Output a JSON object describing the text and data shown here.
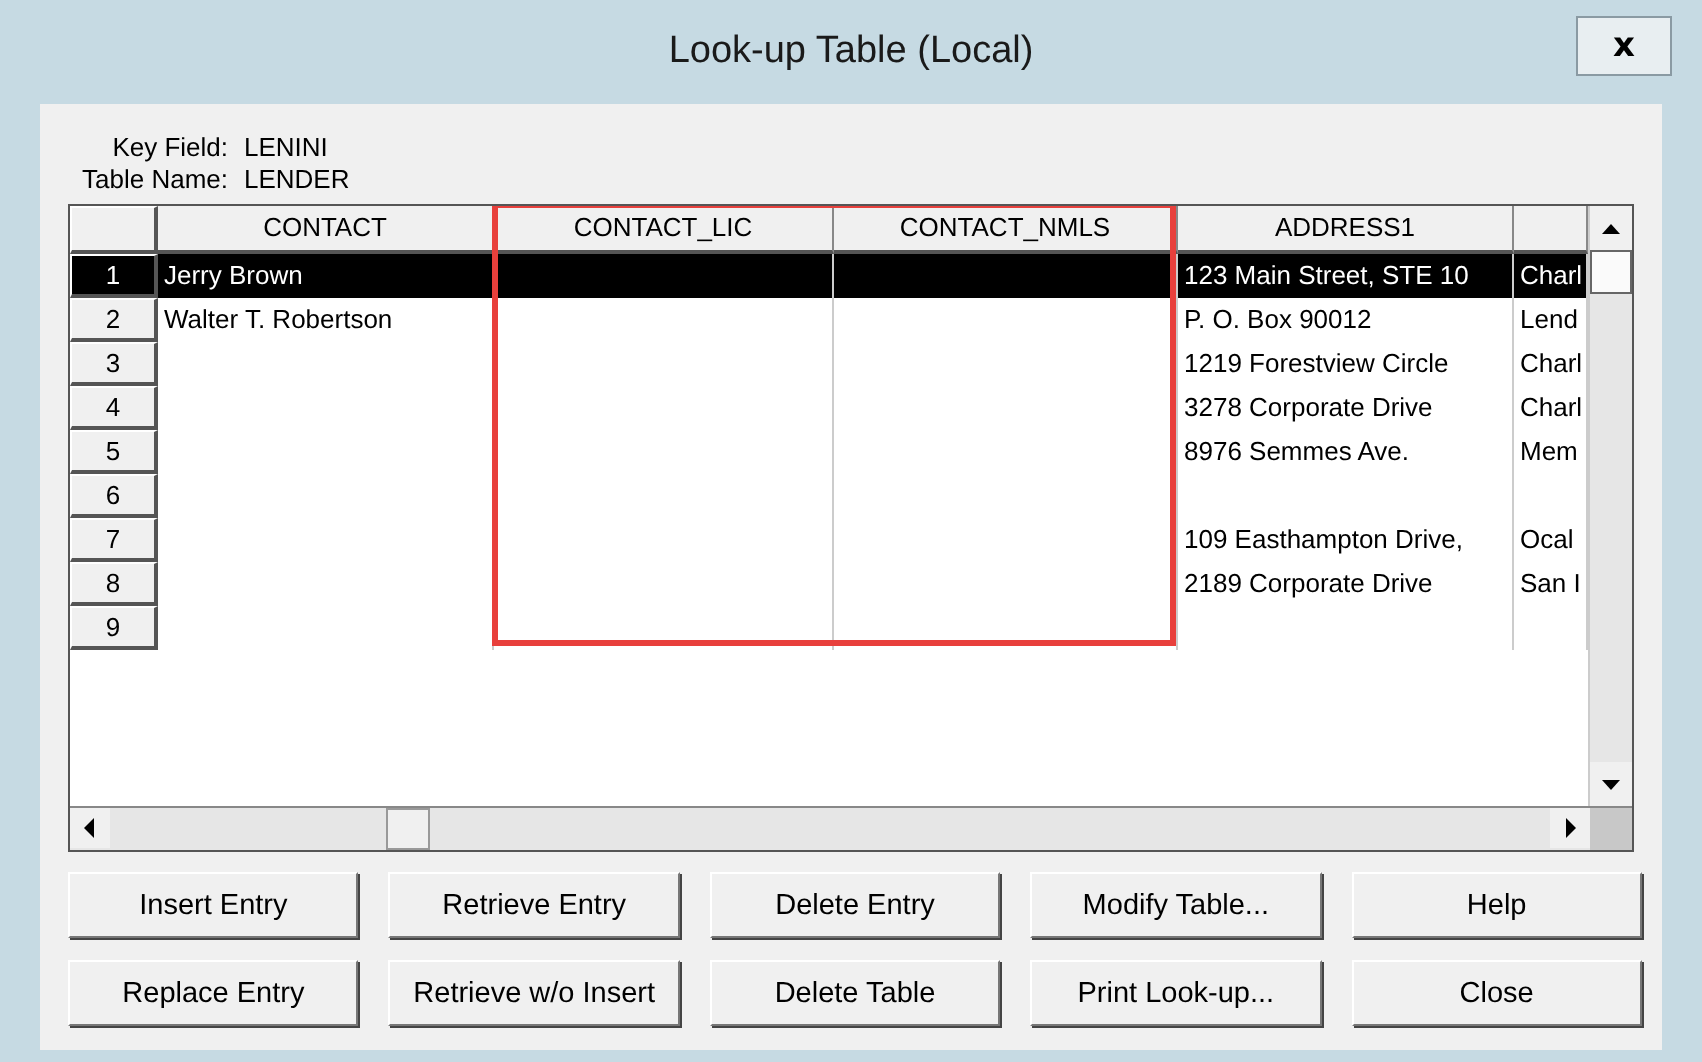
{
  "window": {
    "title": "Look-up Table (Local)",
    "close": "x"
  },
  "key_field": {
    "label": "Key Field:",
    "value": "LENINI"
  },
  "table_name": {
    "label": "Table Name:",
    "value": "LENDER"
  },
  "table": {
    "columns": [
      {
        "label": "CONTACT",
        "highlighted": false
      },
      {
        "label": "CONTACT_LIC",
        "highlighted": true
      },
      {
        "label": "CONTACT_NMLS",
        "highlighted": true
      },
      {
        "label": "ADDRESS1",
        "highlighted": false
      }
    ],
    "rows": [
      {
        "number": "1",
        "selected": true,
        "contact": "Jerry Brown",
        "address1": "123 Main Street, STE 10",
        "column_5": "Charl"
      },
      {
        "number": "2",
        "selected": false,
        "contact": "Walter T. Robertson",
        "address1": "P. O. Box 90012",
        "column_5": "Lend"
      },
      {
        "number": "3",
        "selected": false,
        "address1": "1219 Forestview Circle",
        "column_5": "Charl"
      },
      {
        "number": "4",
        "selected": false,
        "address1": "3278 Corporate Drive",
        "column_5": "Charl"
      },
      {
        "number": "5",
        "selected": false,
        "address1": "8976 Semmes Ave.",
        "column_5": "Mem"
      },
      {
        "number": "6",
        "selected": false
      },
      {
        "number": "7",
        "selected": false,
        "address1": "109 Easthampton Drive,",
        "column_5": "Ocal"
      },
      {
        "number": "8",
        "selected": false,
        "address1": "2189 Corporate Drive",
        "column_5": "San I"
      },
      {
        "number": "9",
        "selected": false
      }
    ]
  },
  "buttons": [
    [
      "Insert Entry",
      "Retrieve Entry",
      "Delete Entry",
      "Modify Table...",
      "Help"
    ],
    [
      "Replace Entry",
      "Retrieve w/o Insert",
      "Delete Table",
      "Print Look-up...",
      "Close"
    ]
  ]
}
